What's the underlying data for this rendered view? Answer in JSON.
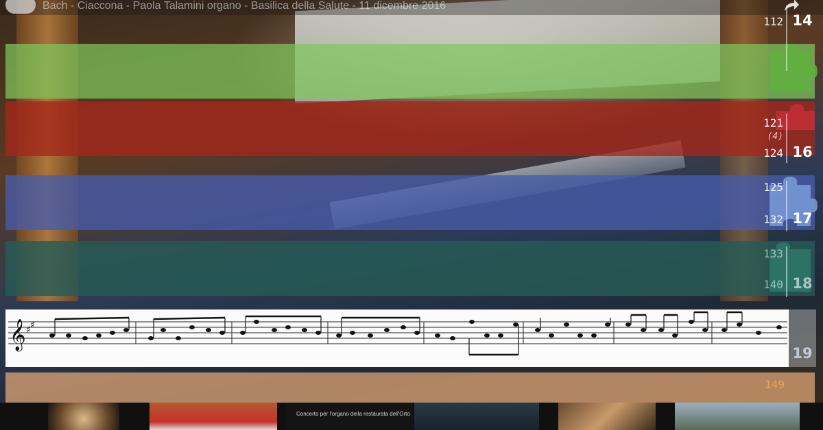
{
  "video": {
    "title": "Bach - Ciaccona - Paola Talamini organo - Basilica della Salute - 11 dicembre 2016"
  },
  "sections": [
    {
      "measure_start": "112",
      "measure_end": "",
      "section": "14",
      "color": "#7ec85c"
    },
    {
      "measure_start": "121",
      "measure_note": "(4)",
      "measure_end": "124",
      "section": "16",
      "color": "#a5261a"
    },
    {
      "measure_start": "125",
      "measure_end": "132",
      "section": "17",
      "color": "#465caa"
    },
    {
      "measure_start": "133",
      "measure_end": "140",
      "section": "18",
      "color": "#265c56"
    },
    {
      "measure_start": "",
      "measure_end": "",
      "section": "19",
      "color": "#fbfbfb"
    },
    {
      "measure_start": "149",
      "measure_end": "",
      "section": "",
      "color": "#e6aa78"
    }
  ],
  "thumbnail_caption": "Concerto per l'organo della restaurata dell'Orto",
  "icons": [
    "channel-logo-icon",
    "share-icon",
    "puzzle-piece-icon",
    "treble-clef-icon"
  ]
}
